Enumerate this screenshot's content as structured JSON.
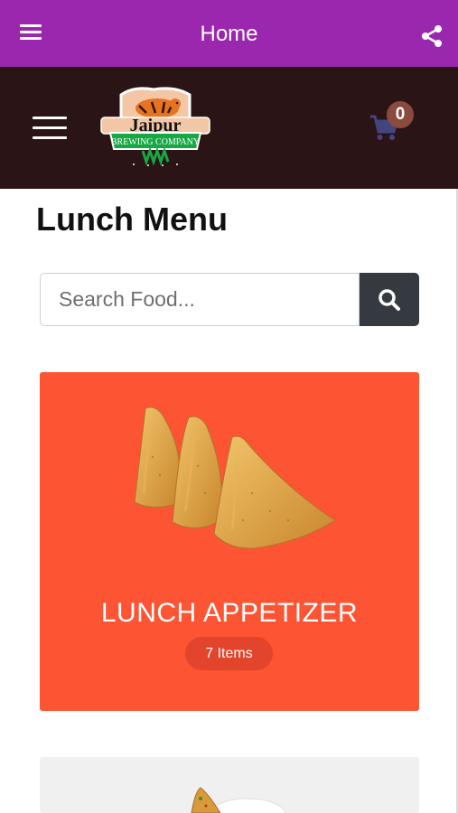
{
  "appbar": {
    "title": "Home",
    "menu_icon": "hamburger-menu-icon",
    "share_icon": "share-icon",
    "color": "#9b27af"
  },
  "header": {
    "logo_text_top": "Jaipur",
    "logo_text_banner": "BREWING COMPANY",
    "cart_count": "0",
    "background": "#2b1415"
  },
  "main": {
    "title": "Lunch Menu",
    "search": {
      "placeholder": "Search Food...",
      "value": ""
    },
    "categories": [
      {
        "label": "LUNCH APPETIZER",
        "count": "7 Items",
        "color": "#fd5434"
      }
    ]
  }
}
